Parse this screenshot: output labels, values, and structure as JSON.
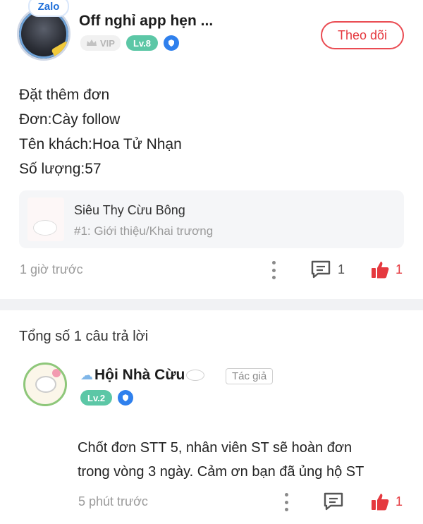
{
  "app_badge": "Zalo",
  "post": {
    "author": "Off nghỉ app hẹn ...",
    "vip_label": "VIP",
    "level": "Lv.8",
    "follow_label": "Theo dõi",
    "body_lines": [
      "Đặt thêm đơn",
      "Đơn:Cày follow",
      "Tên khách:Hoa Tử Nhạn",
      "Số lượng:57"
    ],
    "link_card": {
      "title": "Siêu Thy Cừu Bông",
      "subtitle": "#1: Giới thiệu/Khai trương"
    },
    "time": "1 giờ trước",
    "comment_count": "1",
    "like_count": "1"
  },
  "replies": {
    "total_label": "Tổng số 1 câu trả lời",
    "items": [
      {
        "author": "Hội Nhà Cừu",
        "author_tag": "Tác giả",
        "level": "Lv.2",
        "text_lines": [
          "Chốt đơn STT 5, nhân viên ST sẽ hoàn đơn",
          "trong vòng 3 ngày. Cảm ơn bạn đã ủng hộ ST"
        ],
        "time": "5 phút trước",
        "like_count": "1"
      }
    ]
  },
  "colors": {
    "accent_red": "#e5393f",
    "level_green": "#5cc7a6",
    "shield_blue": "#2f80ed",
    "divider": "#f1f2f4"
  },
  "icons": [
    "more-vertical-icon",
    "comment-icon",
    "thumbs-up-icon",
    "shield-icon",
    "crown-icon"
  ]
}
